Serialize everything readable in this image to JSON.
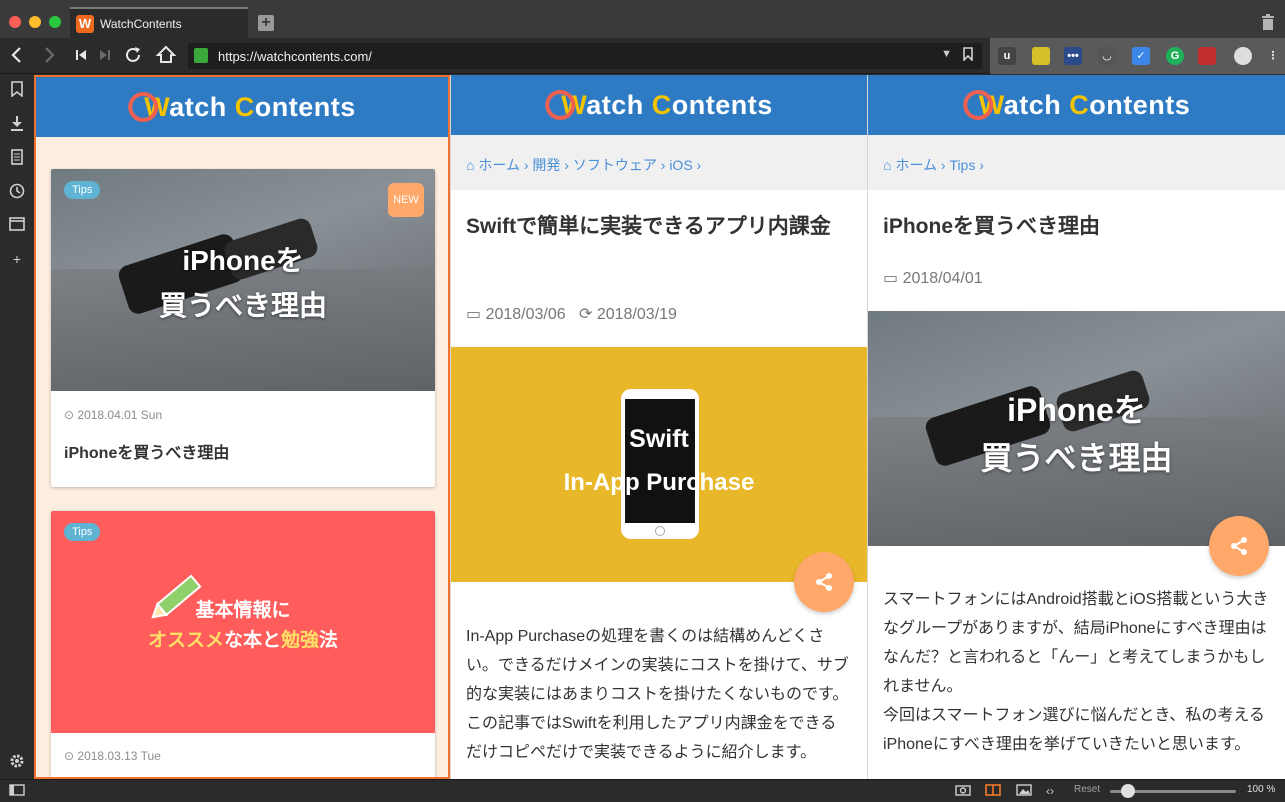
{
  "browser": {
    "tab_title": "WatchContents",
    "tab_favicon": "W",
    "new_tab": "+",
    "url": "https://watchcontents.com/",
    "zoom_reset": "Reset",
    "zoom_level": "100 %",
    "zoom_fraction": 0.14
  },
  "site": {
    "logo_w": "W",
    "logo_rest1": "atch ",
    "logo_c": "C",
    "logo_rest2": "ontents"
  },
  "panel1": {
    "cards": [
      {
        "tag": "Tips",
        "badge": "NEW",
        "thumb_line1": "iPhoneを",
        "thumb_line2": "買うべき理由",
        "date": "2018.04.01 Sun",
        "title": "iPhoneを買うべき理由"
      },
      {
        "tag": "Tips",
        "thumb_line1": "基本情報に",
        "thumb_line2_a": "オススメ",
        "thumb_line2_b": "な本と",
        "thumb_line2_c": "勉強",
        "thumb_line2_d": "法",
        "date": "2018.03.13 Tue"
      }
    ]
  },
  "panel2": {
    "breadcrumb": [
      "ホーム",
      "開発",
      "ソフトウェア",
      "iOS"
    ],
    "title": "Swiftで簡単に実装できるアプリ内課金",
    "date_posted": "2018/03/06",
    "date_updated": "2018/03/19",
    "hero_line1": "Swift",
    "hero_line2": "In-App Purchase",
    "body": "In-App Purchaseの処理を書くのは結構めんどくさい。できるだけメインの実装にコストを掛けて、サブ的な実装にはあまりコストを掛けたくないものです。\nこの記事ではSwiftを利用したアプリ内課金をできるだけコピペだけで実装できるように紹介します。"
  },
  "panel3": {
    "breadcrumb": [
      "ホーム",
      "Tips"
    ],
    "title": "iPhoneを買うべき理由",
    "date": "2018/04/01",
    "hero_line1": "iPhoneを",
    "hero_line2": "買うべき理由",
    "body": "スマートフォンにはAndroid搭載とiOS搭載という大きなグループがありますが、結局iPhoneにすべき理由はなんだ？と言われると「んー」と考えてしまうかもしれません。\n今回はスマートフォン選びに悩んだとき、私の考えるiPhoneにすべき理由を挙げていきたいと思います。"
  },
  "colors": {
    "header_blue": "#2e7bc4",
    "accent_orange": "#ffa86a",
    "tag_blue": "#5fb4d4",
    "link_blue": "#4a90d9",
    "hero_yellow": "#e8b82a",
    "card_red": "#ff5c5c"
  }
}
